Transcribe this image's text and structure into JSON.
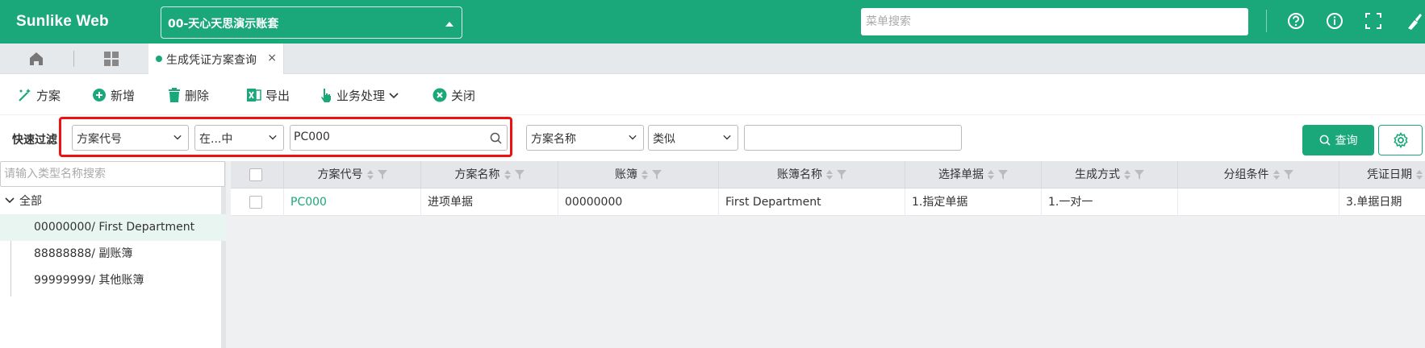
{
  "header": {
    "brand": "Sunlike Web",
    "account": "00-天心天思演示账套",
    "menu_search_placeholder": "菜单搜索",
    "icons": [
      "help-icon",
      "info-icon",
      "fullscreen-icon",
      "brush-icon"
    ]
  },
  "tabs": {
    "home_icon": "home-icon",
    "grid_icon": "apps-grid-icon",
    "active_label": "生成凭证方案查询",
    "close": "×"
  },
  "toolbar": {
    "plan": "方案",
    "add": "新增",
    "delete": "删除",
    "export": "导出",
    "business": "业务处理",
    "close": "关闭"
  },
  "filter": {
    "label": "快速过滤",
    "field1": "方案代号",
    "op1": "在...中",
    "value1": "PC000",
    "field2": "方案名称",
    "op2": "类似",
    "value2": "",
    "query": "查询"
  },
  "tree": {
    "search_placeholder": "请输入类型名称搜索",
    "root": "全部",
    "items": [
      {
        "label": "00000000/ First Department"
      },
      {
        "label": "88888888/ 副账簿"
      },
      {
        "label": "99999999/ 其他账簿"
      }
    ]
  },
  "grid": {
    "columns": [
      "方案代号",
      "方案名称",
      "账簿",
      "账簿名称",
      "选择单据",
      "生成方式",
      "分组条件",
      "凭证日期"
    ],
    "rows": [
      {
        "code": "PC000",
        "name": "进项单据",
        "book": "00000000",
        "book_name": "First Department",
        "select": "1.指定单据",
        "gen": "1.一对一",
        "group": "",
        "date": "3.单据日期"
      }
    ]
  },
  "colors": {
    "brand": "#1aa87a",
    "highlight": "#e11111"
  }
}
